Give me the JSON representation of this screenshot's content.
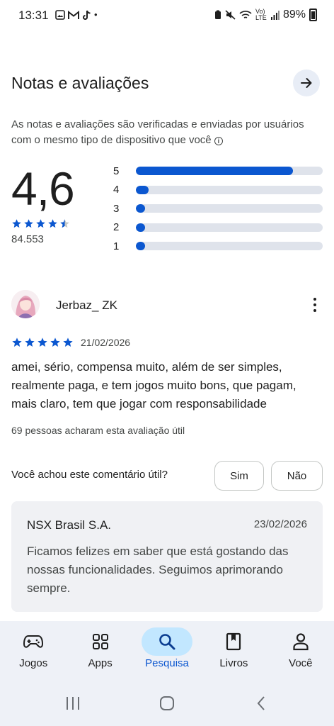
{
  "status_bar": {
    "time": "13:31",
    "battery_percent": "89%",
    "network_label": "Vo) LTE"
  },
  "ratings": {
    "title": "Notas e avaliações",
    "disclaimer": "As notas e avaliações são verificadas e enviadas por usuários com o mesmo tipo de dispositivo que você",
    "average": "4,6",
    "average_stars": 4.5,
    "total_reviews": "84.553",
    "histogram": [
      {
        "label": "5",
        "fraction": 0.84
      },
      {
        "label": "4",
        "fraction": 0.07
      },
      {
        "label": "3",
        "fraction": 0.03
      },
      {
        "label": "2",
        "fraction": 0.03
      },
      {
        "label": "1",
        "fraction": 0.03
      }
    ]
  },
  "review": {
    "author": "Jerbaz_ ZK",
    "stars": 5,
    "date": "21/02/2026",
    "text": "amei, sério, compensa muito, além de ser simples, realmente paga, e tem jogos muito bons, que pagam, mais claro, tem que jogar com responsabilidade",
    "helpful_count": "69 pessoas acharam esta avaliação útil",
    "feedback_question": "Você achou este comentário útil?",
    "yes_label": "Sim",
    "no_label": "Não"
  },
  "developer_reply": {
    "name": "NSX Brasil S.A.",
    "date": "23/02/2026",
    "text": "Ficamos felizes em saber que está gostando das nossas funcionalidades. Seguimos aprimorando sempre."
  },
  "bottom_nav": {
    "items": [
      {
        "label": "Jogos",
        "icon": "gamepad-icon",
        "active": false
      },
      {
        "label": "Apps",
        "icon": "apps-grid-icon",
        "active": false
      },
      {
        "label": "Pesquisa",
        "icon": "search-icon",
        "active": true
      },
      {
        "label": "Livros",
        "icon": "book-icon",
        "active": false
      },
      {
        "label": "Você",
        "icon": "person-icon",
        "active": false
      }
    ]
  },
  "colors": {
    "accent": "#0b57d0",
    "active_nav_bg": "#c2e7ff",
    "bar_track": "#dfe3eb"
  }
}
